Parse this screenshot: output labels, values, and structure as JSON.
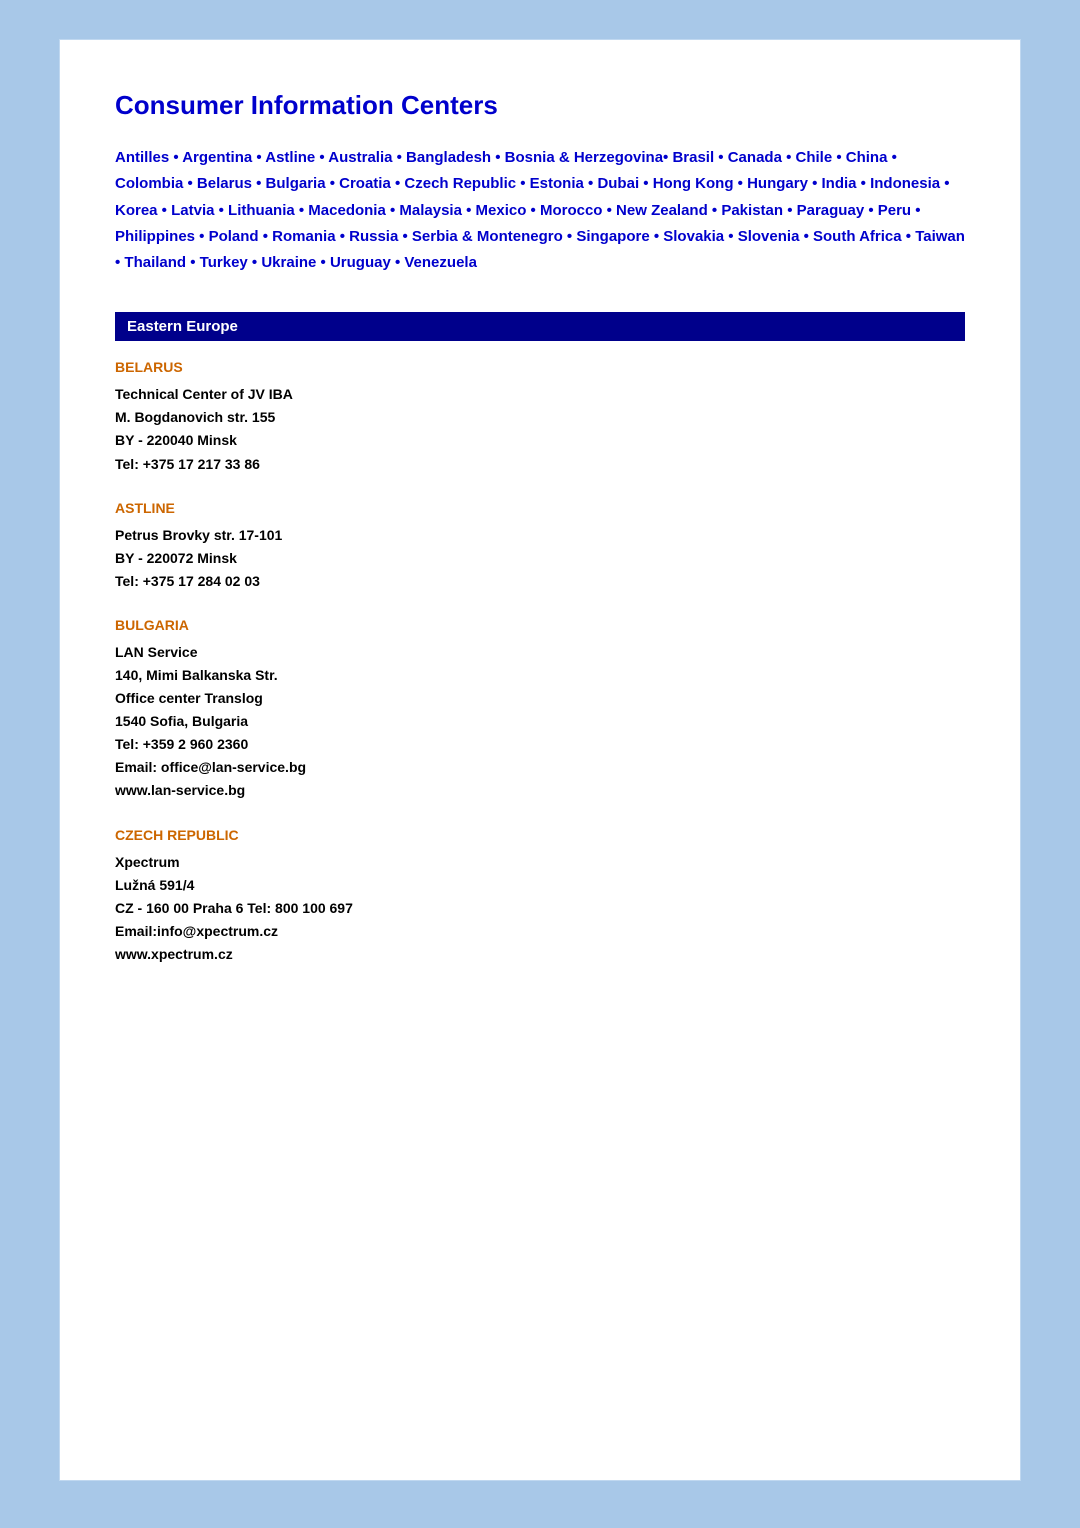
{
  "title": "Consumer Information Centers",
  "country_links_text": "Antilles • Argentina • Astline • Australia • Bangladesh • Bosnia & Herzegovina• Brasil • Canada • Chile • China • Colombia • Belarus • Bulgaria • Croatia • Czech Republic • Estonia • Dubai •  Hong Kong • Hungary • India • Indonesia • Korea • Latvia • Lithuania • Macedonia • Malaysia • Mexico • Morocco • New Zealand • Pakistan • Paraguay • Peru • Philippines • Poland • Romania • Russia • Serbia & Montenegro • Singapore • Slovakia • Slovenia • South Africa • Taiwan • Thailand • Turkey • Ukraine • Uruguay • Venezuela",
  "section_header": "Eastern Europe",
  "countries": [
    {
      "id": "belarus",
      "name": "BELARUS",
      "info": "Technical Center of JV IBA\nM. Bogdanovich str. 155\nBY - 220040 Minsk\nTel: +375 17 217 33 86"
    },
    {
      "id": "astline",
      "name": "ASTLINE",
      "info": "Petrus Brovky str. 17-101\nBY - 220072 Minsk\nTel: +375 17 284 02 03"
    },
    {
      "id": "bulgaria",
      "name": "BULGARIA",
      "info": "LAN Service\n140, Mimi Balkanska Str.\nOffice center Translog\n1540 Sofia, Bulgaria\nTel: +359 2 960 2360\nEmail: office@lan-service.bg\nwww.lan-service.bg"
    },
    {
      "id": "czech-republic",
      "name": "CZECH REPUBLIC",
      "info": "Xpectrum\nLužná 591/4\nCZ - 160 00 Praha 6 Tel: 800 100 697\nEmail:info@xpectrum.cz\nwww.xpectrum.cz"
    }
  ]
}
